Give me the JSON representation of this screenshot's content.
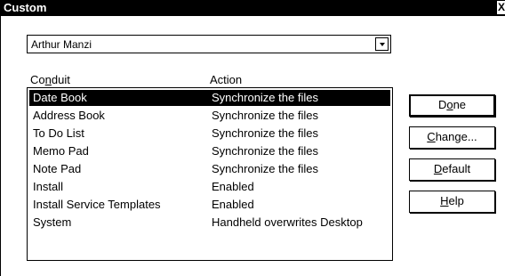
{
  "window": {
    "title": "Custom",
    "close_glyph": "X"
  },
  "user_select": {
    "value": "Arthur Manzi"
  },
  "columns": {
    "conduit": {
      "pre": "Co",
      "u": "n",
      "post": "duit"
    },
    "action": "Action"
  },
  "conduits": [
    {
      "name": "Date Book",
      "action": "Synchronize the files",
      "selected": true
    },
    {
      "name": "Address Book",
      "action": "Synchronize the files",
      "selected": false
    },
    {
      "name": "To Do List",
      "action": "Synchronize the files",
      "selected": false
    },
    {
      "name": "Memo Pad",
      "action": "Synchronize the files",
      "selected": false
    },
    {
      "name": "Note Pad",
      "action": "Synchronize the files",
      "selected": false
    },
    {
      "name": "Install",
      "action": "Enabled",
      "selected": false
    },
    {
      "name": "Install Service Templates",
      "action": "Enabled",
      "selected": false
    },
    {
      "name": "System",
      "action": "Handheld overwrites Desktop",
      "selected": false
    }
  ],
  "buttons": {
    "done": {
      "pre": "D",
      "u": "o",
      "post": "ne"
    },
    "change": {
      "pre": "",
      "u": "C",
      "post": "hange..."
    },
    "default": {
      "pre": "",
      "u": "D",
      "post": "efault"
    },
    "help": {
      "pre": "",
      "u": "H",
      "post": "elp"
    }
  }
}
